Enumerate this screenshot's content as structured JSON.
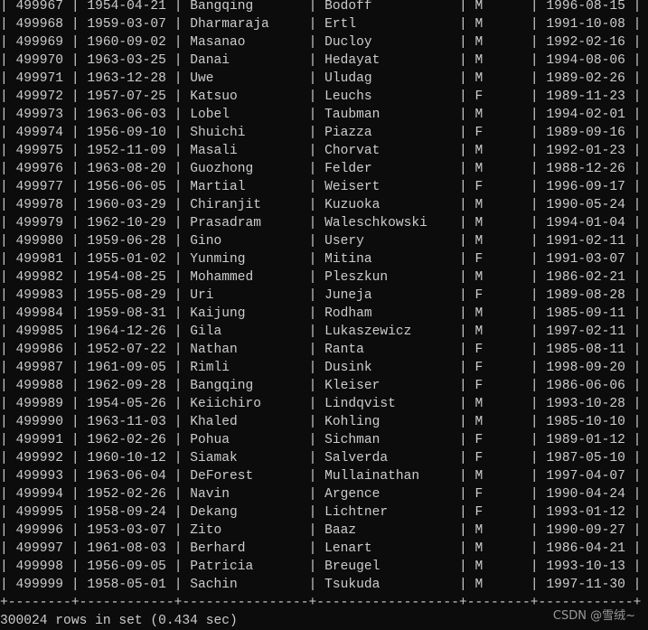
{
  "colors": {
    "background": "#0c0c0c",
    "text": "#cccccc"
  },
  "rows": [
    [
      "499967",
      "1954-04-21",
      "Bangqing",
      "Bodoff",
      "M",
      "1996-08-15"
    ],
    [
      "499968",
      "1959-03-07",
      "Dharmaraja",
      "Ertl",
      "M",
      "1991-10-08"
    ],
    [
      "499969",
      "1960-09-02",
      "Masanao",
      "Ducloy",
      "M",
      "1992-02-16"
    ],
    [
      "499970",
      "1963-03-25",
      "Danai",
      "Hedayat",
      "M",
      "1994-08-06"
    ],
    [
      "499971",
      "1963-12-28",
      "Uwe",
      "Uludag",
      "M",
      "1989-02-26"
    ],
    [
      "499972",
      "1957-07-25",
      "Katsuo",
      "Leuchs",
      "F",
      "1989-11-23"
    ],
    [
      "499973",
      "1963-06-03",
      "Lobel",
      "Taubman",
      "M",
      "1994-02-01"
    ],
    [
      "499974",
      "1956-09-10",
      "Shuichi",
      "Piazza",
      "F",
      "1989-09-16"
    ],
    [
      "499975",
      "1952-11-09",
      "Masali",
      "Chorvat",
      "M",
      "1992-01-23"
    ],
    [
      "499976",
      "1963-08-20",
      "Guozhong",
      "Felder",
      "M",
      "1988-12-26"
    ],
    [
      "499977",
      "1956-06-05",
      "Martial",
      "Weisert",
      "F",
      "1996-09-17"
    ],
    [
      "499978",
      "1960-03-29",
      "Chiranjit",
      "Kuzuoka",
      "M",
      "1990-05-24"
    ],
    [
      "499979",
      "1962-10-29",
      "Prasadram",
      "Waleschkowski",
      "M",
      "1994-01-04"
    ],
    [
      "499980",
      "1959-06-28",
      "Gino",
      "Usery",
      "M",
      "1991-02-11"
    ],
    [
      "499981",
      "1955-01-02",
      "Yunming",
      "Mitina",
      "F",
      "1991-03-07"
    ],
    [
      "499982",
      "1954-08-25",
      "Mohammed",
      "Pleszkun",
      "M",
      "1986-02-21"
    ],
    [
      "499983",
      "1955-08-29",
      "Uri",
      "Juneja",
      "F",
      "1989-08-28"
    ],
    [
      "499984",
      "1959-08-31",
      "Kaijung",
      "Rodham",
      "M",
      "1985-09-11"
    ],
    [
      "499985",
      "1964-12-26",
      "Gila",
      "Lukaszewicz",
      "M",
      "1997-02-11"
    ],
    [
      "499986",
      "1952-07-22",
      "Nathan",
      "Ranta",
      "F",
      "1985-08-11"
    ],
    [
      "499987",
      "1961-09-05",
      "Rimli",
      "Dusink",
      "F",
      "1998-09-20"
    ],
    [
      "499988",
      "1962-09-28",
      "Bangqing",
      "Kleiser",
      "F",
      "1986-06-06"
    ],
    [
      "499989",
      "1954-05-26",
      "Keiichiro",
      "Lindqvist",
      "M",
      "1993-10-28"
    ],
    [
      "499990",
      "1963-11-03",
      "Khaled",
      "Kohling",
      "M",
      "1985-10-10"
    ],
    [
      "499991",
      "1962-02-26",
      "Pohua",
      "Sichman",
      "F",
      "1989-01-12"
    ],
    [
      "499992",
      "1960-10-12",
      "Siamak",
      "Salverda",
      "F",
      "1987-05-10"
    ],
    [
      "499993",
      "1963-06-04",
      "DeForest",
      "Mullainathan",
      "M",
      "1997-04-07"
    ],
    [
      "499994",
      "1952-02-26",
      "Navin",
      "Argence",
      "F",
      "1990-04-24"
    ],
    [
      "499995",
      "1958-09-24",
      "Dekang",
      "Lichtner",
      "F",
      "1993-01-12"
    ],
    [
      "499996",
      "1953-03-07",
      "Zito",
      "Baaz",
      "M",
      "1990-09-27"
    ],
    [
      "499997",
      "1961-08-03",
      "Berhard",
      "Lenart",
      "M",
      "1986-04-21"
    ],
    [
      "499998",
      "1956-09-05",
      "Patricia",
      "Breugel",
      "M",
      "1993-10-13"
    ],
    [
      "499999",
      "1958-05-01",
      "Sachin",
      "Tsukuda",
      "M",
      "1997-11-30"
    ]
  ],
  "summary": "300024 rows in set (0.434 sec)",
  "watermark": "CSDN @雪绒~"
}
